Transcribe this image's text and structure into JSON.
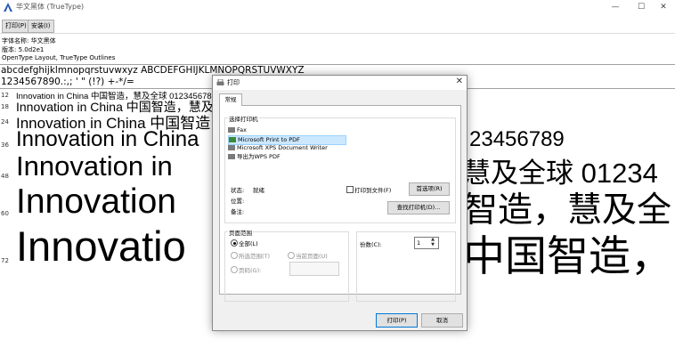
{
  "window": {
    "title": "华文黑体 (TrueType)",
    "controls": {
      "minimize": "—",
      "maximize": "☐",
      "close": "✕"
    }
  },
  "toolbar": {
    "print_label": "打印(P)",
    "install_label": "安装(I)"
  },
  "font_info": {
    "name_line": "字体名称: 华文黑体",
    "version_line": "版本: 5.0d2e1",
    "type_line": "OpenType Layout, TrueType Outlines"
  },
  "charset": {
    "line1": "abcdefghijklmnopqrstuvwxyz ABCDEFGHIJKLMNOPQRSTUVWXYZ",
    "line2": "1234567890.:,; ' \" (!?) +-*/="
  },
  "sample_rows": [
    {
      "size": "12",
      "text": "Innovation in China 中国智造，慧及全球 0123456789"
    },
    {
      "size": "18",
      "text": "Innovation in China 中国智造，慧及全"
    },
    {
      "size": "24",
      "text": "Innovation in China 中国智造"
    },
    {
      "size": "36",
      "text": "Innovation in China",
      "right": "23456789"
    },
    {
      "size": "48",
      "text": "Innovation in",
      "right": "慧及全球 01234"
    },
    {
      "size": "60",
      "text": "Innovation",
      "right": "智造，慧及全"
    },
    {
      "size": "72",
      "text": "Innovatio",
      "right": "中国智造，"
    }
  ],
  "dialog": {
    "title": "打印",
    "close": "✕",
    "tab_general": "常规",
    "select_printer_title": "选择打印机",
    "printers": [
      {
        "name": "Fax",
        "selected": false
      },
      {
        "name": "Microsoft Print to PDF",
        "selected": true
      },
      {
        "name": "Microsoft XPS Document Writer",
        "selected": false
      },
      {
        "name": "导出为WPS PDF",
        "selected": false
      }
    ],
    "status_label": "状态:",
    "status_value": "就绪",
    "location_label": "位置:",
    "comment_label": "备注:",
    "print_to_file_label": "打印到文件(F)",
    "preferences_button": "首选项(R)",
    "find_printer_button": "查找打印机(D)...",
    "page_range_title": "页面范围",
    "range_all": "全部(L)",
    "range_selection": "所选范围(T)",
    "range_current": "当前页面(U)",
    "range_pages": "页码(G):",
    "copies_label": "份数(C):",
    "copies_value": "1",
    "print_button": "打印(P)",
    "cancel_button": "取消"
  }
}
